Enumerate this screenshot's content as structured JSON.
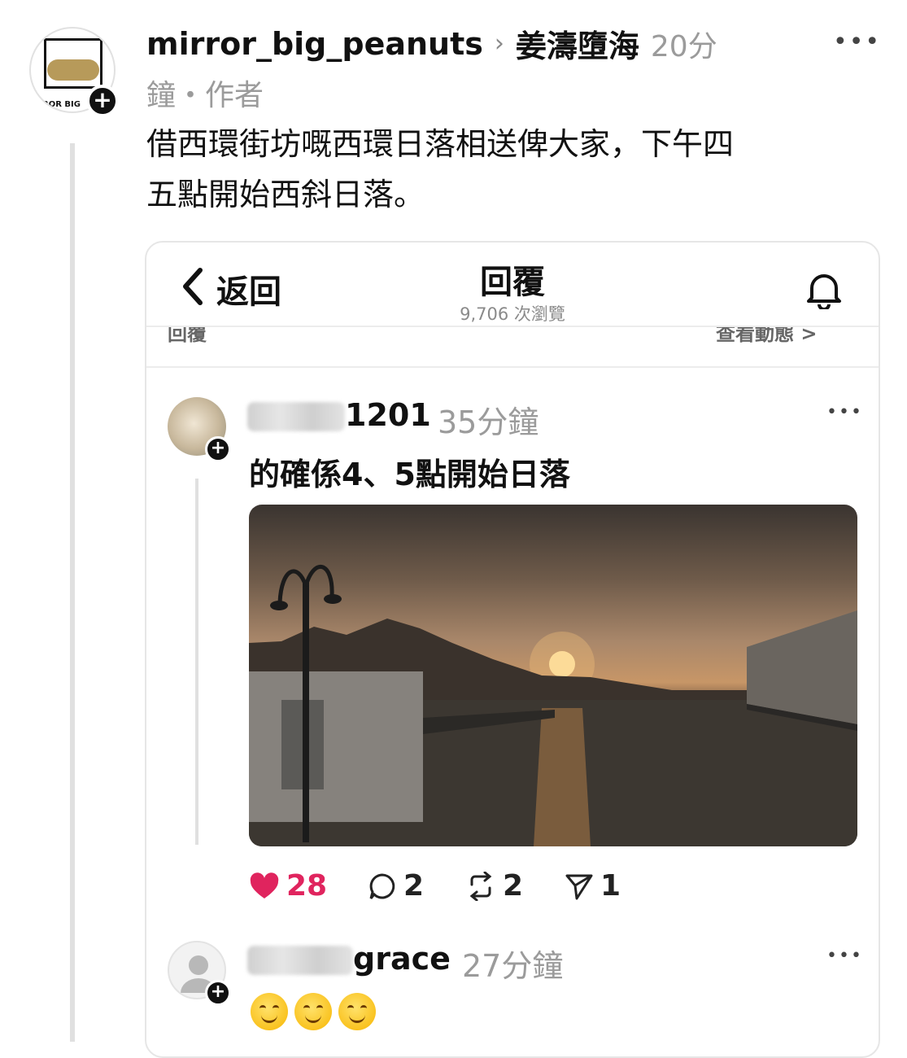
{
  "post": {
    "username": "mirror_big_peanuts",
    "target": "姜濤墮海",
    "time_part1": "20分",
    "time_part2": "鐘・作者",
    "text_line1": "借西環街坊嘅西環日落相送俾大家，下午四",
    "text_line2": "五點開始西斜日落。",
    "logo_text": "ROR BIG",
    "more": "•••"
  },
  "embedded": {
    "back_label": "返回",
    "title": "回覆",
    "views": "9,706 次瀏覽",
    "cut_left": "回覆",
    "cut_right": "查看動態 >",
    "reply1": {
      "name_suffix": "1201",
      "time": "35分鐘",
      "text": "的確係4、5點開始日落",
      "likes": "28",
      "comments": "2",
      "reposts": "2",
      "shares": "1"
    },
    "reply2": {
      "name_suffix": "grace",
      "time": "27分鐘"
    }
  },
  "icons": {
    "like": "heart-icon",
    "comment": "comment-icon",
    "repost": "repost-icon",
    "share": "send-icon",
    "bell": "bell-icon",
    "back": "chevron-left-icon"
  },
  "colors": {
    "like": "#e0245e",
    "muted": "#9b9b9b"
  }
}
